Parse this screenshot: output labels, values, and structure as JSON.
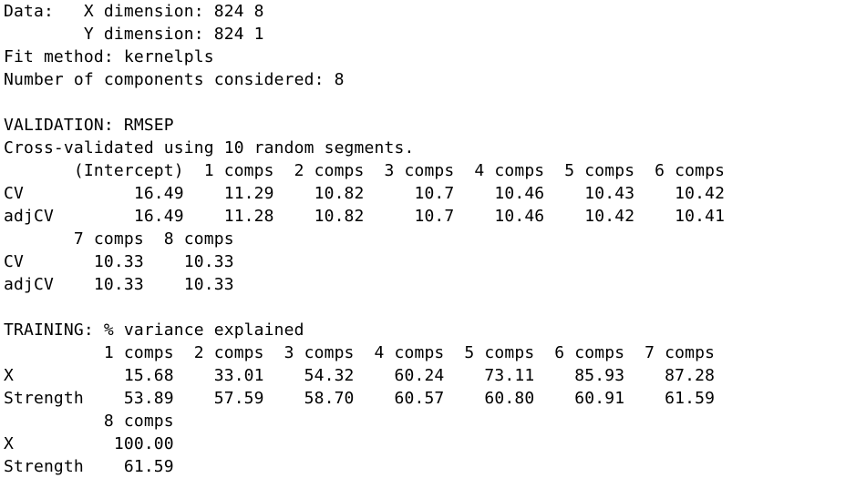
{
  "console": {
    "lines": [
      "Data:   X dimension: 824 8",
      "        Y dimension: 824 1",
      "Fit method: kernelpls",
      "Number of components considered: 8",
      "",
      "VALIDATION: RMSEP",
      "Cross-validated using 10 random segments.",
      "       (Intercept)  1 comps  2 comps  3 comps  4 comps  5 comps  6 comps",
      "CV           16.49    11.29    10.82     10.7    10.46    10.43    10.42",
      "adjCV        16.49    11.28    10.82     10.7    10.46    10.42    10.41",
      "       7 comps  8 comps",
      "CV       10.33    10.33",
      "adjCV    10.33    10.33",
      "",
      "TRAINING: % variance explained",
      "          1 comps  2 comps  3 comps  4 comps  5 comps  6 comps  7 comps",
      "X           15.68    33.01    54.32    60.24    73.11    85.93    87.28",
      "Strength    53.89    57.59    58.70    60.57    60.80    60.91    61.59",
      "          8 comps",
      "X          100.00",
      "Strength    61.59"
    ]
  }
}
